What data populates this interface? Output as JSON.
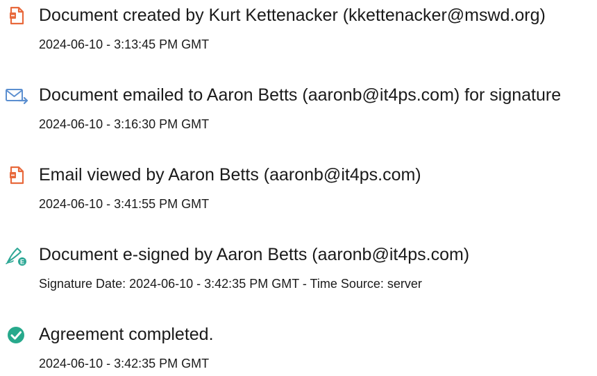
{
  "events": [
    {
      "icon": "document-created-icon",
      "title": "Document created by Kurt Kettenacker (kkettenacker@mswd.org)",
      "detail": "2024-06-10 - 3:13:45 PM GMT"
    },
    {
      "icon": "email-sent-icon",
      "title": "Document emailed to Aaron Betts (aaronb@it4ps.com) for signature",
      "detail": "2024-06-10 - 3:16:30 PM GMT"
    },
    {
      "icon": "email-viewed-icon",
      "title": "Email viewed by Aaron Betts (aaronb@it4ps.com)",
      "detail": "2024-06-10 - 3:41:55 PM GMT"
    },
    {
      "icon": "esign-pen-icon",
      "title": "Document e-signed by Aaron Betts (aaronb@it4ps.com)",
      "detail": "Signature Date: 2024-06-10 - 3:42:35 PM GMT - Time Source: server"
    },
    {
      "icon": "check-circle-icon",
      "title": "Agreement completed.",
      "detail": "2024-06-10 - 3:42:35 PM GMT"
    }
  ],
  "colors": {
    "orange_icon": "#e8693c",
    "blue_icon": "#5b8fd0",
    "teal_icon": "#2fa896",
    "green_icon": "#27a98c",
    "text": "#1a1a1a"
  }
}
